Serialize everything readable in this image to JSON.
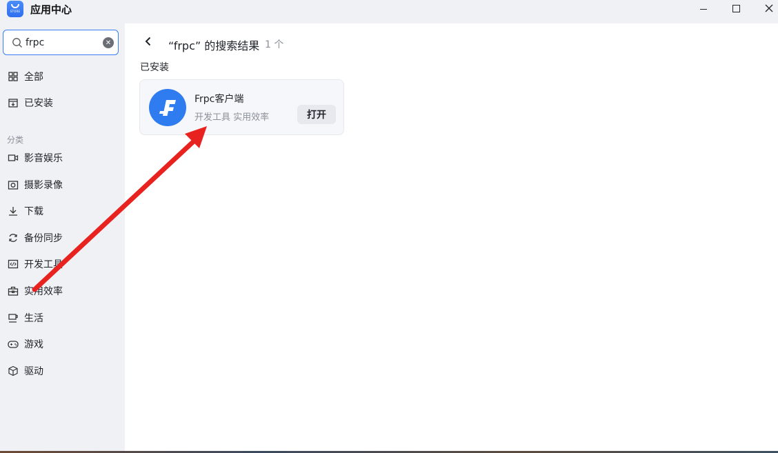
{
  "window": {
    "title": "应用中心",
    "logo_text": "STORE",
    "minimize": "—",
    "maximize": "☐",
    "close": "×"
  },
  "search": {
    "value": "frpc",
    "placeholder": "",
    "clear_icon": "clear-icon"
  },
  "sidebar": {
    "top_items": [
      {
        "label": "全部",
        "icon": "grid-icon"
      },
      {
        "label": "已安装",
        "icon": "install-box-icon"
      }
    ],
    "section_label": "分类",
    "categories": [
      {
        "label": "影音娱乐",
        "icon": "video-camera-icon"
      },
      {
        "label": "摄影录像",
        "icon": "camera-icon"
      },
      {
        "label": "下载",
        "icon": "download-icon"
      },
      {
        "label": "备份同步",
        "icon": "sync-icon"
      },
      {
        "label": "开发工具",
        "icon": "code-icon"
      },
      {
        "label": "实用效率",
        "icon": "toolbox-icon"
      },
      {
        "label": "生活",
        "icon": "cup-icon"
      },
      {
        "label": "游戏",
        "icon": "gamepad-icon"
      },
      {
        "label": "驱动",
        "icon": "cube-icon"
      }
    ]
  },
  "main": {
    "back_icon": "chevron-left-icon",
    "result_title": "“frpc” 的搜索结果",
    "result_count": "1 个",
    "installed_label": "已安装",
    "app": {
      "name": "Frpc客户端",
      "tags": "开发工具 实用效率",
      "open_label": "打开",
      "icon": "frpc-logo-icon"
    }
  },
  "colors": {
    "accent": "#3a7bf5",
    "sidebar_bg": "#f0f1f5",
    "main_bg": "#ffffff",
    "arrow": "#e8231f",
    "logo_blue": "#2f7cf0"
  }
}
